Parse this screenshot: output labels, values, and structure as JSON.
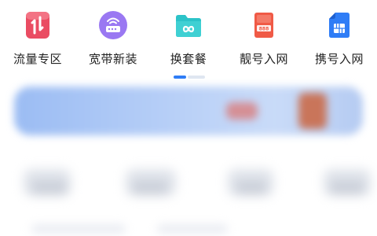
{
  "nav": {
    "items": [
      {
        "label": "流量专区",
        "icon": "traffic-zone-icon"
      },
      {
        "label": "宽带新装",
        "icon": "broadband-router-icon"
      },
      {
        "label": "换套餐",
        "icon": "change-plan-folder-icon"
      },
      {
        "label": "靓号入网",
        "icon": "lucky-number-icon"
      },
      {
        "label": "携号入网",
        "icon": "sim-card-icon"
      }
    ]
  },
  "colors": {
    "accent": "#2f7df6",
    "traffic_icon": "#ea4c62",
    "router_icon": "#9a78f2",
    "folder_icon": "#2cc3c8",
    "number_icon": "#f05a46",
    "sim_icon": "#2f7df6"
  }
}
